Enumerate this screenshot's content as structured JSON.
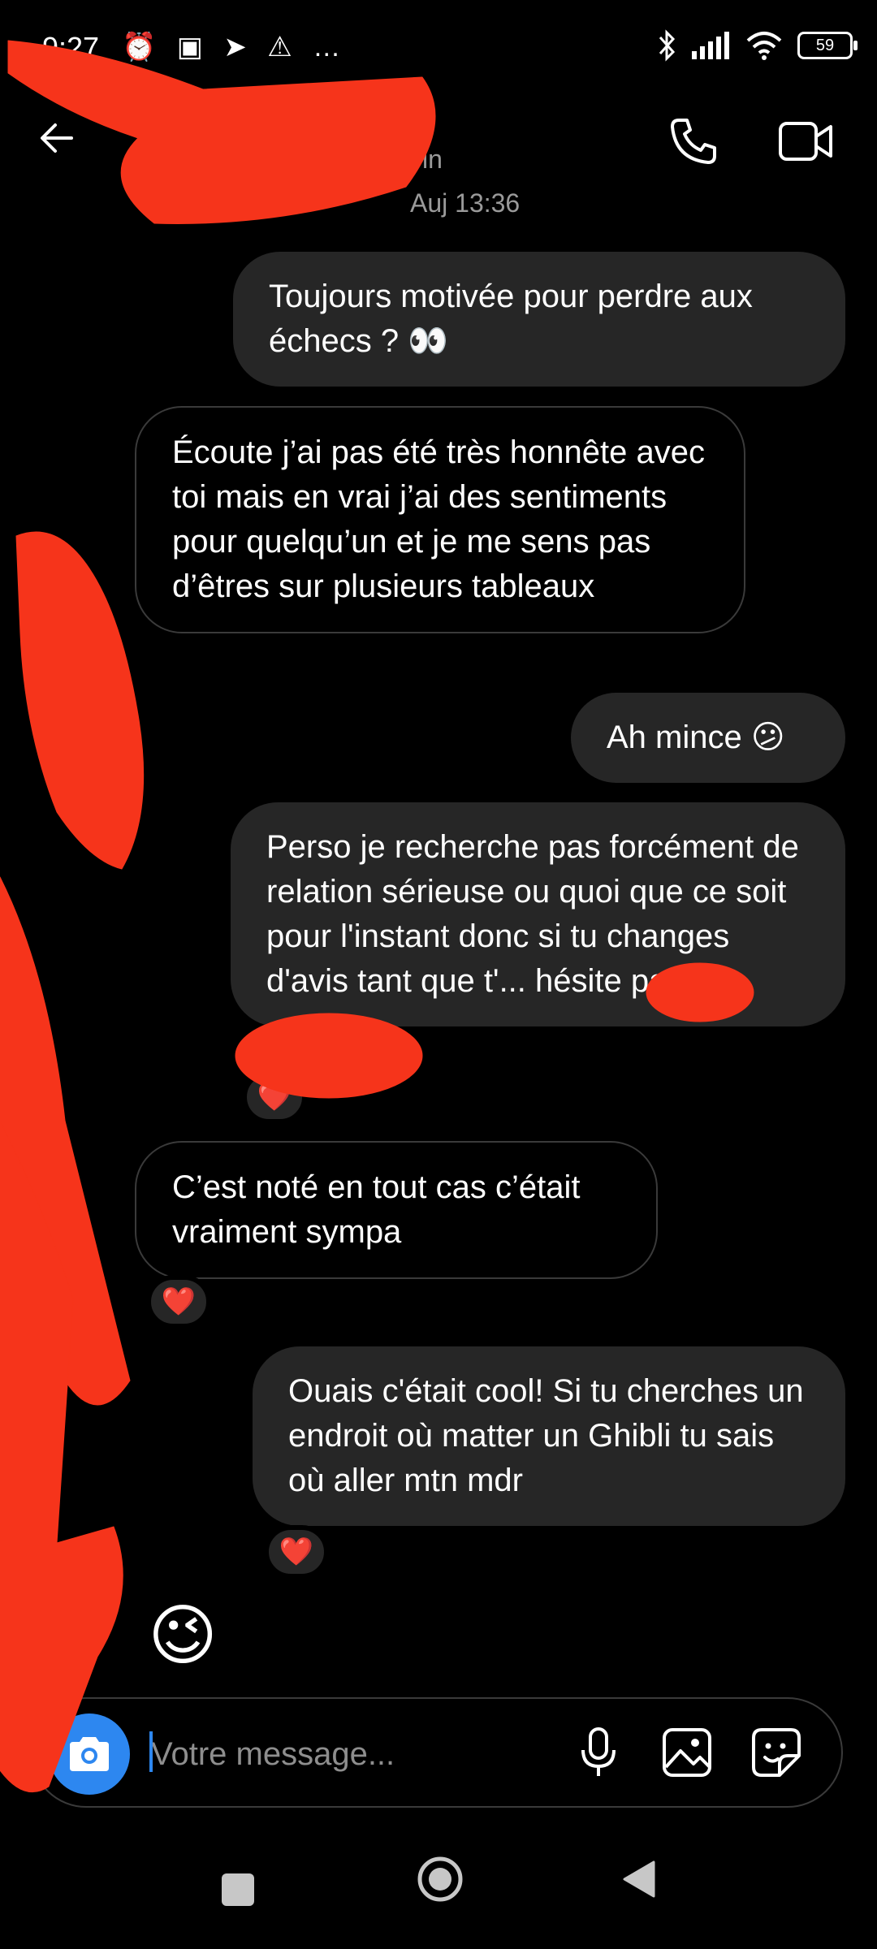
{
  "status_bar": {
    "time": "9:27",
    "left_icons": "⏰ ▣ ➤ ⚠ …",
    "battery": "59"
  },
  "header": {
    "username_fragment": "in",
    "timestamp": "Auj 13:36"
  },
  "messages": [
    {
      "side": "sent",
      "text": "Toujours motivée pour perdre aux échecs ? 👀"
    },
    {
      "side": "received",
      "text": "Écoute j’ai pas été très honnête avec toi mais en vrai j’ai des sentiments pour quelqu’un et je me sens pas d’êtres sur plusieurs tableaux"
    },
    {
      "side": "sent",
      "text": "Ah mince 😕"
    },
    {
      "side": "sent",
      "text": "Perso je recherche pas forcément de relation sérieuse ou quoi que ce soit pour l'instant donc si tu changes d'avis tant que t'... hésite pas 😅",
      "reaction": "❤️"
    },
    {
      "side": "received",
      "text": "C’est noté en tout cas c’était vraiment sympa",
      "reaction": "❤️"
    },
    {
      "side": "sent",
      "text": "Ouais c'était cool! Si tu cherches un endroit où matter un Ghibli tu sais où aller mtn mdr",
      "reaction": "❤️"
    }
  ],
  "last_emoji": "😉",
  "composer": {
    "placeholder": "Votre message..."
  },
  "colors": {
    "background": "#000000",
    "sent_bubble": "#262626",
    "received_border": "#3a3a3a",
    "camera_button": "#2d87f0",
    "redaction": "#f6341b"
  }
}
